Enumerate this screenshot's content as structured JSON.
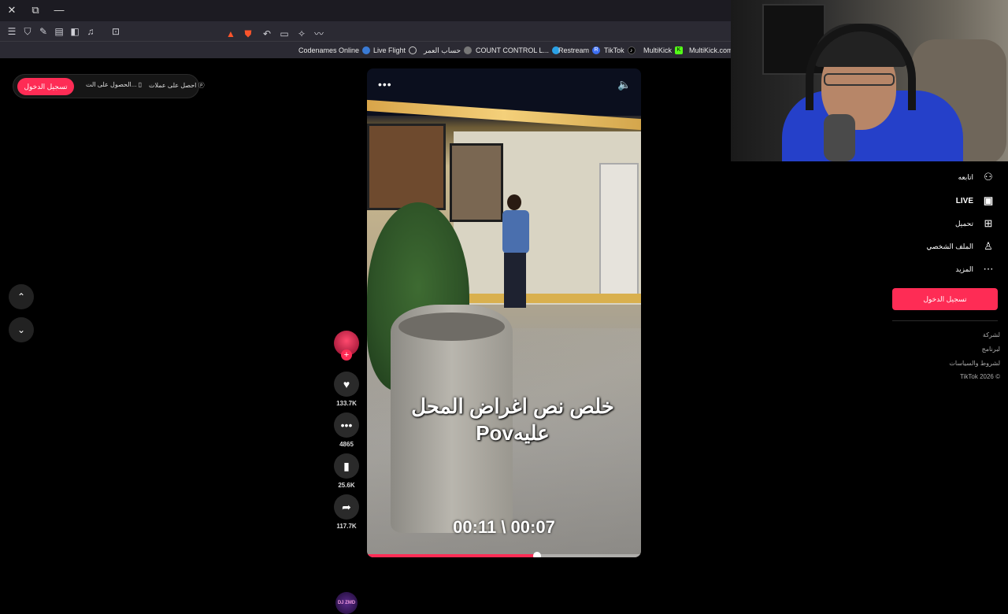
{
  "browser": {
    "window_controls": {
      "close": "✕",
      "restore": "⧉",
      "minimize": "—"
    },
    "bookmarks": [
      {
        "label": "Codenames Online",
        "icon": "codenames-icon"
      },
      {
        "label": "Live Flight",
        "icon": "flight-icon"
      },
      {
        "label": "حساب العمر",
        "icon": "age-calc-icon"
      },
      {
        "label": "COUNT CONTROL L...",
        "icon": "count-icon"
      },
      {
        "label": "Restream",
        "icon": "restream-icon",
        "badge": "R"
      },
      {
        "label": "TikTok",
        "icon": "tiktok-icon"
      },
      {
        "label": "MultiKick",
        "icon": "kick-icon",
        "badge": "K"
      },
      {
        "label": "MultiKick.com",
        "icon": "kick-icon"
      }
    ],
    "accent": "#fe2c55"
  },
  "topbar": {
    "login_label": "تسجيل الدخول",
    "get_app_label": "الحصول على الت...",
    "get_coins_label": "احصل على عملات"
  },
  "video": {
    "caption_line1": "خلص نص اغراض المحل",
    "caption_line2": "عليهPov",
    "timestamp": "00:11 \\ 00:07",
    "progress_fraction": 0.62,
    "menu_label": "•••",
    "sound_label": "🔈"
  },
  "actions": {
    "likes": "133.7K",
    "comments": "4865",
    "saves": "25.6K",
    "shares": "117.7K",
    "music_label": "DJ ZMD"
  },
  "sidebar": {
    "items": [
      {
        "label": "اتابعه",
        "icon": "follow-user-icon"
      },
      {
        "label": "LIVE",
        "icon": "live-tv-icon"
      },
      {
        "label": "تحميل",
        "icon": "upload-plus-icon"
      },
      {
        "label": "الملف الشخصي",
        "icon": "profile-icon"
      },
      {
        "label": "المزيد",
        "icon": "more-dots-icon"
      }
    ],
    "login_label": "تسجيل الدخول",
    "footer": [
      "لشركة",
      "لبرنامج",
      "لشروط والسياسات",
      "TikTok 2026 ©"
    ]
  }
}
